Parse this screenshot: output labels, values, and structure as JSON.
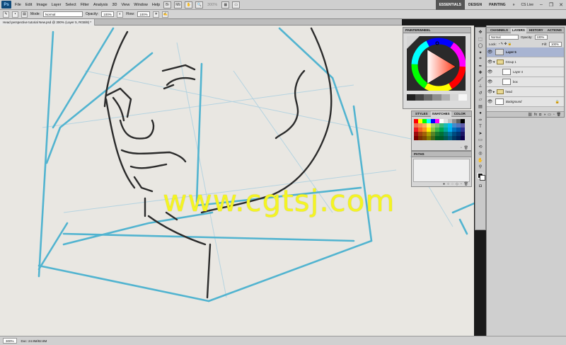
{
  "app": {
    "logo": "Ps"
  },
  "menu": [
    "File",
    "Edit",
    "Image",
    "Layer",
    "Select",
    "Filter",
    "Analysis",
    "3D",
    "View",
    "Window",
    "Help"
  ],
  "menubar": {
    "zoom": "300%",
    "workspaces": [
      "ESSENTIALS",
      "DESIGN",
      "PAINTING"
    ],
    "more": "»",
    "cslive": "CS Live"
  },
  "options": {
    "mode_label": "Mode:",
    "mode_value": "Normal",
    "opacity_label": "Opacity:",
    "opacity_value": "100%",
    "flow_label": "Flow:",
    "flow_value": "100%"
  },
  "document": {
    "tab_title": "Head perspective tutorial New.psd @ 300% (Layer 5, RGB/8) *"
  },
  "status": {
    "zoom": "300%",
    "doc": "Doc: 24.9M/82.8M"
  },
  "painterwheel": {
    "title": "PAINTERWHEEL",
    "swatches": [
      "#202020",
      "#444444",
      "#6a6a6a",
      "#8e8e8e",
      "#b0b0b0",
      "#d6d6d6",
      "#f6f6f6"
    ]
  },
  "swatches_panel": {
    "tabs": [
      "STYLES",
      "SWATCHES",
      "COLOR"
    ],
    "colors": [
      "#ff0000",
      "#ffff00",
      "#00ff00",
      "#00ffff",
      "#0000ff",
      "#ff00ff",
      "#ffffff",
      "#e0e0e0",
      "#c0c0c0",
      "#909090",
      "#606060",
      "#000000",
      "#f26c4f",
      "#f68e55",
      "#fbaf5c",
      "#fff467",
      "#acd372",
      "#7cc576",
      "#3bb878",
      "#1abbb4",
      "#00bff3",
      "#438ccb",
      "#5574b9",
      "#605ca8",
      "#ed1c24",
      "#f26522",
      "#f7941d",
      "#fff200",
      "#8dc63f",
      "#39b54a",
      "#00a651",
      "#00a99d",
      "#00aeef",
      "#0072bc",
      "#0054a6",
      "#2e3192",
      "#9e0b0f",
      "#a0410d",
      "#a36209",
      "#aba000",
      "#598527",
      "#1a7b30",
      "#007236",
      "#00746b",
      "#0076a3",
      "#004b80",
      "#003471",
      "#1b1464",
      "#790000",
      "#7b2e00",
      "#7d4900",
      "#827b00",
      "#406618",
      "#005e20",
      "#005826",
      "#005952",
      "#005b7f",
      "#003663",
      "#002157",
      "#0d004c"
    ]
  },
  "paths_panel": {
    "title": "PATHS"
  },
  "layers_panel": {
    "tabs": [
      "CHANNELS",
      "LAYERS",
      "HISTORY",
      "ACTIONS"
    ],
    "blend": "Normal",
    "opacity_label": "Opacity:",
    "opacity": "100%",
    "lock_label": "Lock:",
    "fill_label": "Fill:",
    "fill": "100%",
    "rows": [
      "Layer 5",
      "Group 1",
      "Layer 4",
      "box",
      "head",
      "Background"
    ]
  },
  "tools": [
    "move",
    "marquee",
    "lasso",
    "quick-select",
    "crop",
    "eyedropper",
    "heal",
    "brush",
    "stamp",
    "history-brush",
    "eraser",
    "gradient",
    "dodge",
    "pen",
    "type",
    "path-select",
    "shape",
    "3d-rotate",
    "3d-orbit",
    "hand",
    "zoom"
  ],
  "watermark": "www.cgtsj.com"
}
